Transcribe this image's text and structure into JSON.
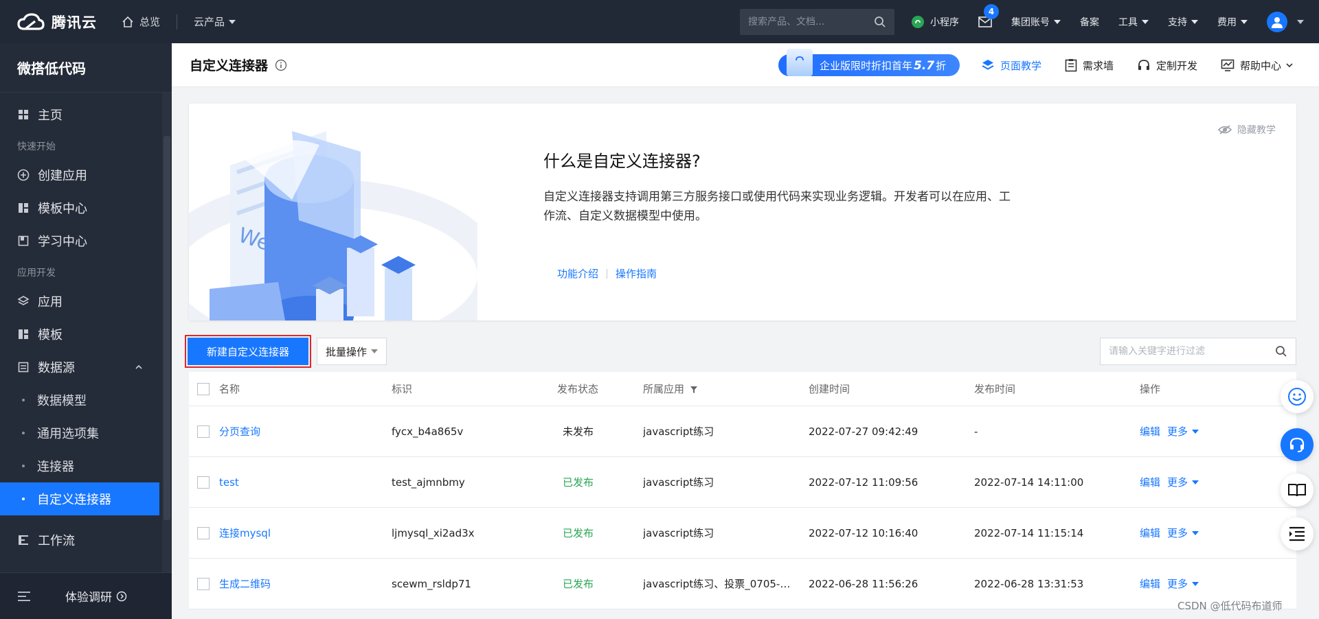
{
  "topbar": {
    "brand": "腾讯云",
    "home": "总览",
    "products": "云产品",
    "search_placeholder": "搜索产品、文档...",
    "mini_program": "小程序",
    "mail_badge": "4",
    "group_account": "集团账号",
    "beian": "备案",
    "tools": "工具",
    "support": "支持",
    "fees": "费用"
  },
  "sidebar": {
    "title": "微搭低代码",
    "home": "主页",
    "group_quickstart": "快速开始",
    "create_app": "创建应用",
    "template_center": "模板中心",
    "learning_center": "学习中心",
    "group_dev": "应用开发",
    "apps": "应用",
    "templates": "模板",
    "datasource": "数据源",
    "sub_items": [
      "数据模型",
      "通用选项集",
      "连接器",
      "自定义连接器"
    ],
    "workflow": "工作流",
    "survey": "体验调研"
  },
  "header": {
    "title": "自定义连接器",
    "promo_prefix": "企业版限时折扣首年",
    "promo_num": "5.7",
    "promo_suffix": "折",
    "tutorial": "页面教学",
    "wall": "需求墙",
    "custom_dev": "定制开发",
    "help": "帮助中心"
  },
  "intro": {
    "hide": "隐藏教学",
    "heading": "什么是自定义连接器?",
    "desc": "自定义连接器支持调用第三方服务接口或使用代码来实现业务逻辑。开发者可以在应用、工作流、自定义数据模型中使用。",
    "link_features": "功能介绍",
    "link_guide": "操作指南",
    "art_text": "WeDa"
  },
  "toolbar": {
    "create": "新建自定义连接器",
    "batch": "批量操作",
    "filter_placeholder": "请输入关键字进行过滤"
  },
  "table": {
    "headers": {
      "name": "名称",
      "id": "标识",
      "status": "发布状态",
      "app": "所属应用",
      "created": "创建时间",
      "published": "发布时间",
      "ops": "操作"
    },
    "edit": "编辑",
    "more": "更多",
    "rows": [
      {
        "name": "分页查询",
        "id": "fycx_b4a865v",
        "status": "未发布",
        "app": "javascript练习",
        "created": "2022-07-27 09:42:49",
        "published": "-"
      },
      {
        "name": "test",
        "id": "test_ajmnbmy",
        "status": "已发布",
        "app": "javascript练习",
        "created": "2022-07-12 11:09:56",
        "published": "2022-07-14 14:11:00"
      },
      {
        "name": "连接mysql",
        "id": "ljmysql_xi2ad3x",
        "status": "已发布",
        "app": "javascript练习",
        "created": "2022-07-12 10:16:40",
        "published": "2022-07-14 11:15:14"
      },
      {
        "name": "生成二维码",
        "id": "scewm_rsldp71",
        "status": "已发布",
        "app": "javascript练习、投票_0705-管...",
        "created": "2022-06-28 11:56:26",
        "published": "2022-06-28 13:31:53"
      }
    ]
  },
  "watermark": "CSDN @低代码布道师",
  "colors": {
    "accent": "#1877ff",
    "topbar": "#222936",
    "sidebar": "#252c39",
    "published": "#29a554",
    "highlight": "#e02525"
  }
}
